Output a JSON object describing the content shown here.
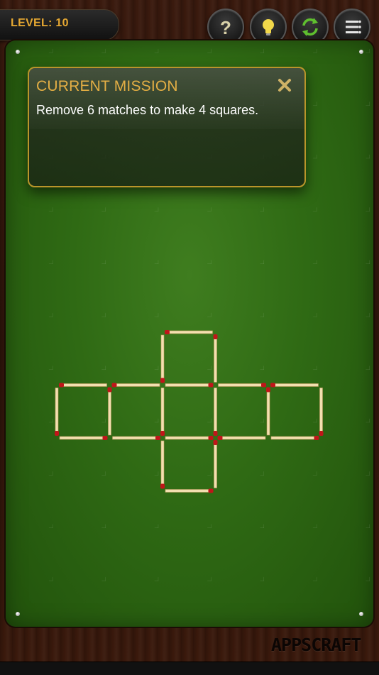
{
  "header": {
    "level_label": "LEVEL: 10",
    "buttons": [
      {
        "name": "help",
        "icon": "question-icon"
      },
      {
        "name": "hint",
        "icon": "lightbulb-icon"
      },
      {
        "name": "restart",
        "icon": "refresh-icon"
      },
      {
        "name": "menu",
        "icon": "menu-icon"
      }
    ]
  },
  "mission": {
    "title": "CURRENT MISSION",
    "text": "Remove 6 matches to make 4 squares.",
    "close_icon": "close-icon"
  },
  "puzzle": {
    "match_count": 22,
    "shape": "cross of 6 squares",
    "grid_unit_cells": [
      [
        2,
        0
      ],
      [
        0,
        1
      ],
      [
        1,
        1
      ],
      [
        2,
        1
      ],
      [
        3,
        1
      ],
      [
        4,
        1
      ],
      [
        2,
        2
      ]
    ]
  },
  "footer": {
    "brand": "APPSCRAFT"
  },
  "colors": {
    "felt": "#2f6a14",
    "wood": "#2d140a",
    "accent": "#e0a530",
    "panel_border": "#b9952a",
    "match_stick": "#f3dfb0",
    "match_head": "#c0161a"
  }
}
